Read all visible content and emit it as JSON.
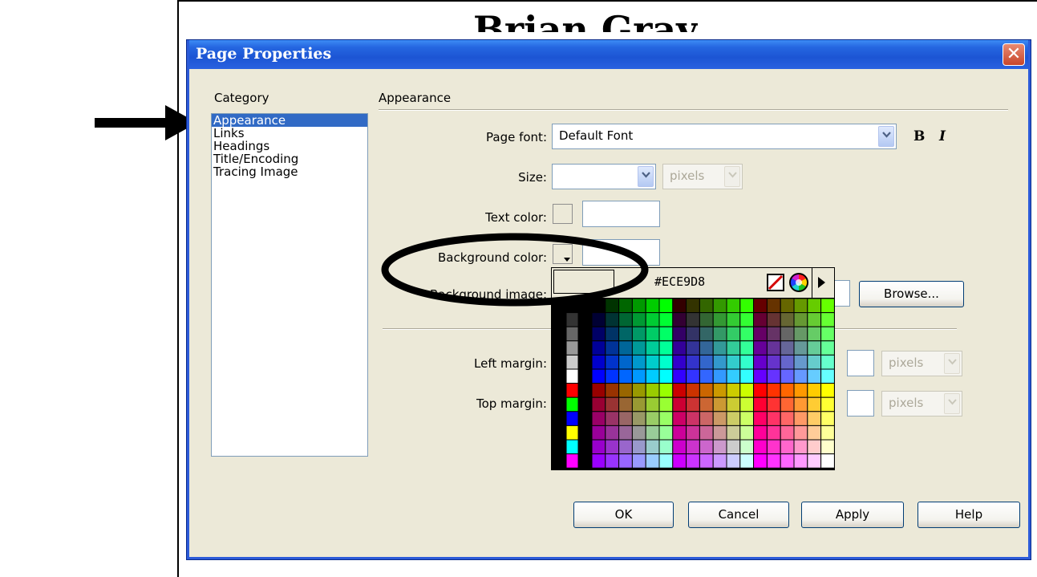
{
  "document": {
    "heading": "Brian Gray"
  },
  "dialog": {
    "title": "Page Properties",
    "close_label": "✕",
    "category_label": "Category",
    "categories": [
      "Appearance",
      "Links",
      "Headings",
      "Title/Encoding",
      "Tracing Image"
    ],
    "selected_category": "Appearance",
    "section_label": "Appearance",
    "page_font_label": "Page font:",
    "page_font_value": "Default Font",
    "bold_label": "B",
    "italic_label": "I",
    "size_label": "Size:",
    "size_unit": "pixels",
    "text_color_label": "Text color:",
    "background_color_label": "Background color:",
    "background_image_label": "Background image:",
    "browse_label": "Browse...",
    "left_margin_label": "Left margin:",
    "top_margin_label": "Top margin:",
    "margin_unit": "pixels",
    "ok_label": "OK",
    "cancel_label": "Cancel",
    "apply_label": "Apply",
    "help_label": "Help"
  },
  "color_picker": {
    "hex_value": "#ECE9D8",
    "current_color": "#ECE9D8",
    "icons": [
      "no-color-icon",
      "system-color-picker-icon",
      "menu-arrow-icon"
    ]
  },
  "annotations": {
    "arrow_target": "Appearance",
    "ellipse_target": "Background color"
  },
  "colors": {
    "titlebar": "#1c55d4",
    "selection": "#316ac5",
    "dialog_bg": "#ece9d8"
  }
}
